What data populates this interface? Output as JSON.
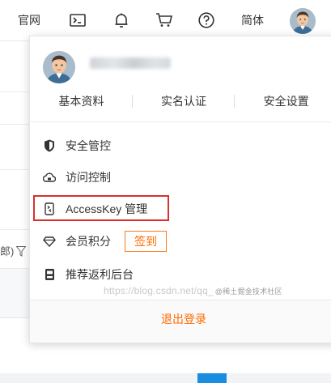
{
  "topbar": {
    "official_site": "官网",
    "language": "简体",
    "icons": [
      "terminal-icon",
      "bell-icon",
      "cart-icon",
      "help-icon"
    ]
  },
  "background": {
    "truncated_text": "郎)"
  },
  "panel": {
    "tabs": [
      {
        "label": "基本资料"
      },
      {
        "label": "实名认证"
      },
      {
        "label": "安全设置"
      }
    ],
    "menu": [
      {
        "label": "安全管控",
        "icon": "shield-icon"
      },
      {
        "label": "访问控制",
        "icon": "cloud-lock-icon"
      },
      {
        "label": "AccessKey 管理",
        "icon": "key-card-icon"
      },
      {
        "label": "会员积分",
        "icon": "diamond-icon"
      },
      {
        "label": "推荐返利后台",
        "icon": "rebate-icon"
      }
    ],
    "signin_label": "签到",
    "logout_label": "退出登录"
  },
  "watermark": {
    "text": "https://blog.csdn.net/qq_",
    "suffix": "@稀土掘金技术社区"
  },
  "colors": {
    "accent": "#ff6a00",
    "highlight": "#d9312c"
  }
}
